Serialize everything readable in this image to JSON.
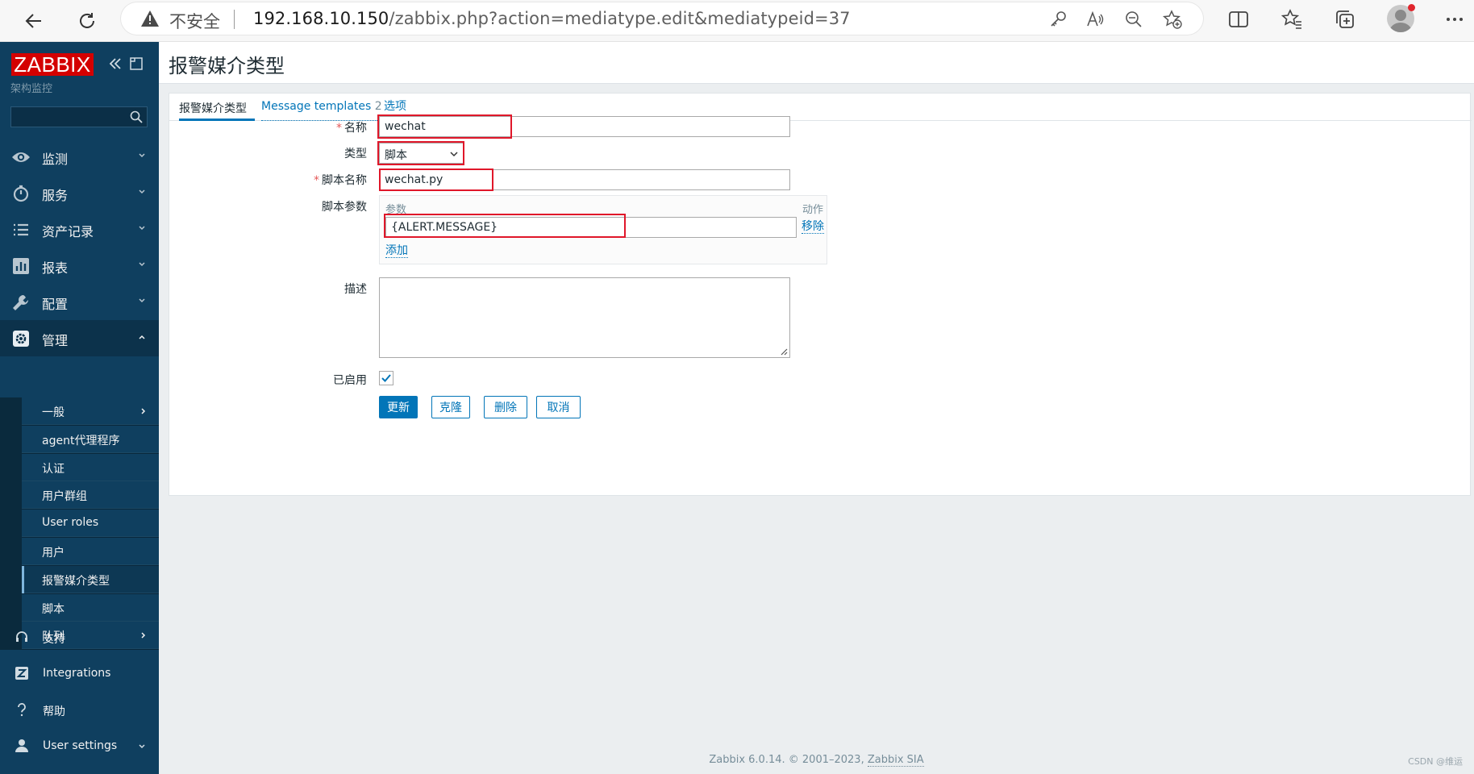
{
  "browser": {
    "security_label": "不安全",
    "url_host": "192.168.10.150",
    "url_path": "/zabbix.php?action=mediatype.edit&mediatypeid=37"
  },
  "sidebar": {
    "logo": "ZABBIX",
    "subtitle": "架构监控",
    "search_placeholder": "",
    "menu": [
      {
        "label": "监测",
        "icon": "eye-icon"
      },
      {
        "label": "服务",
        "icon": "stopwatch-icon"
      },
      {
        "label": "资产记录",
        "icon": "list-icon"
      },
      {
        "label": "报表",
        "icon": "bar-chart-icon"
      },
      {
        "label": "配置",
        "icon": "wrench-icon"
      },
      {
        "label": "管理",
        "icon": "gear-icon"
      }
    ],
    "admin_submenu": [
      {
        "label": "一般"
      },
      {
        "label": "agent代理程序"
      },
      {
        "label": "认证"
      },
      {
        "label": "用户群组"
      },
      {
        "label": "User roles"
      },
      {
        "label": "用户"
      },
      {
        "label": "报警媒介类型"
      },
      {
        "label": "脚本"
      },
      {
        "label": "队列"
      }
    ],
    "footer_menu": [
      {
        "label": "支持",
        "icon": "headset-icon"
      },
      {
        "label": "Integrations",
        "icon": "integrations-icon"
      },
      {
        "label": "帮助",
        "icon": "question-icon"
      },
      {
        "label": "User settings",
        "icon": "user-icon"
      }
    ]
  },
  "page": {
    "title": "报警媒介类型",
    "tabs": {
      "media_type": "报警媒介类型",
      "message_templates": "Message templates",
      "message_templates_count": "2",
      "options": "选项"
    }
  },
  "form": {
    "name_label": "名称",
    "name_value": "wechat",
    "type_label": "类型",
    "type_value": "脚本",
    "script_name_label": "脚本名称",
    "script_name_value": "wechat.py",
    "script_params_label": "脚本参数",
    "params_header": "参数",
    "action_header": "动作",
    "param_value": "{ALERT.MESSAGE}",
    "remove_link": "移除",
    "add_link": "添加",
    "description_label": "描述",
    "description_value": "",
    "enabled_label": "已启用",
    "enabled": true
  },
  "buttons": {
    "update": "更新",
    "clone": "克隆",
    "delete": "删除",
    "cancel": "取消"
  },
  "footer": {
    "copyright": "Zabbix 6.0.14. © 2001–2023,",
    "company": "Zabbix SIA"
  },
  "watermark": "CSDN @维运",
  "colors": {
    "sidebar": "#0f3f5f",
    "accent": "#0275b8",
    "logo_red": "#d40000",
    "highlight_red": "#e0172a"
  }
}
